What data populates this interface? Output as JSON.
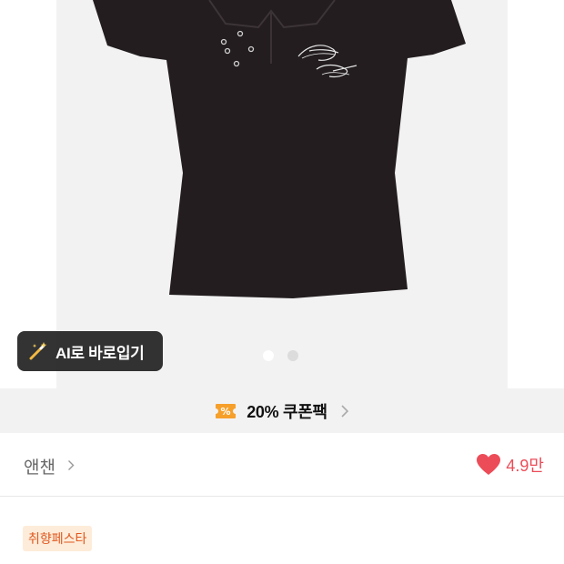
{
  "gallery": {
    "ai_button_label": "AI로 바로입기",
    "page_dots": 2,
    "active_dot": 0
  },
  "coupon": {
    "label": "20% 쿠폰팩",
    "icon": "coupon-ticket-icon",
    "accent": "#f6a02b"
  },
  "seller": {
    "name": "앤챈"
  },
  "likes": {
    "count": "4.9만",
    "color": "#ec4c58"
  },
  "tags": [
    {
      "label": "취향페스타"
    }
  ]
}
